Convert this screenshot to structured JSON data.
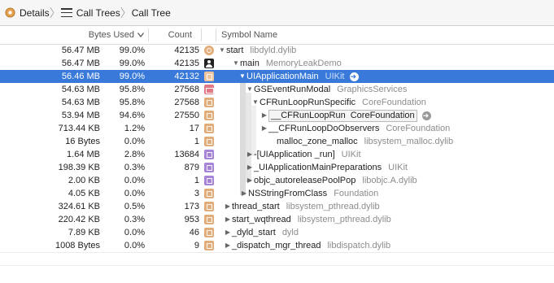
{
  "breadcrumb": {
    "items": [
      {
        "label": "Details"
      },
      {
        "label": "Call Trees"
      },
      {
        "label": "Call Tree"
      }
    ]
  },
  "columns": {
    "bytes_used": "Bytes Used",
    "count": "Count",
    "symbol_name": "Symbol Name"
  },
  "rows": [
    {
      "bytes": "56.47 MB",
      "pct": "99.0%",
      "count": "42135",
      "symbol": "start",
      "lib": "libdyld.dylib"
    },
    {
      "bytes": "56.47 MB",
      "pct": "99.0%",
      "count": "42135",
      "symbol": "main",
      "lib": "MemoryLeakDemo"
    },
    {
      "bytes": "56.46 MB",
      "pct": "99.0%",
      "count": "42132",
      "symbol": "UIApplicationMain",
      "lib": "UIKit"
    },
    {
      "bytes": "54.63 MB",
      "pct": "95.8%",
      "count": "27568",
      "symbol": "GSEventRunModal",
      "lib": "GraphicsServices"
    },
    {
      "bytes": "54.63 MB",
      "pct": "95.8%",
      "count": "27568",
      "symbol": "CFRunLoopRunSpecific",
      "lib": "CoreFoundation"
    },
    {
      "bytes": "53.94 MB",
      "pct": "94.6%",
      "count": "27550",
      "symbol": "__CFRunLoopRun",
      "lib": "CoreFoundation"
    },
    {
      "bytes": "713.44 KB",
      "pct": "1.2%",
      "count": "17",
      "symbol": "__CFRunLoopDoObservers",
      "lib": "CoreFoundation"
    },
    {
      "bytes": "16 Bytes",
      "pct": "0.0%",
      "count": "1",
      "symbol": "malloc_zone_malloc",
      "lib": "libsystem_malloc.dylib"
    },
    {
      "bytes": "1.64 MB",
      "pct": "2.8%",
      "count": "13684",
      "symbol": "-[UIApplication _run]",
      "lib": "UIKit"
    },
    {
      "bytes": "198.39 KB",
      "pct": "0.3%",
      "count": "879",
      "symbol": "_UIApplicationMainPreparations",
      "lib": "UIKit"
    },
    {
      "bytes": "2.00 KB",
      "pct": "0.0%",
      "count": "1",
      "symbol": "objc_autoreleasePoolPop",
      "lib": "libobjc.A.dylib"
    },
    {
      "bytes": "4.05 KB",
      "pct": "0.0%",
      "count": "3",
      "symbol": "NSStringFromClass",
      "lib": "Foundation"
    },
    {
      "bytes": "324.61 KB",
      "pct": "0.5%",
      "count": "173",
      "symbol": "thread_start",
      "lib": "libsystem_pthread.dylib"
    },
    {
      "bytes": "220.42 KB",
      "pct": "0.3%",
      "count": "953",
      "symbol": "start_wqthread",
      "lib": "libsystem_pthread.dylib"
    },
    {
      "bytes": "7.89 KB",
      "pct": "0.0%",
      "count": "46",
      "symbol": "_dyld_start",
      "lib": "dyld"
    },
    {
      "bytes": "1008 Bytes",
      "pct": "0.0%",
      "count": "9",
      "symbol": "_dispatch_mgr_thread",
      "lib": "libdispatch.dylib"
    }
  ],
  "colors": {
    "selection": "#3879d9",
    "library_text": "#8c8c8c"
  }
}
